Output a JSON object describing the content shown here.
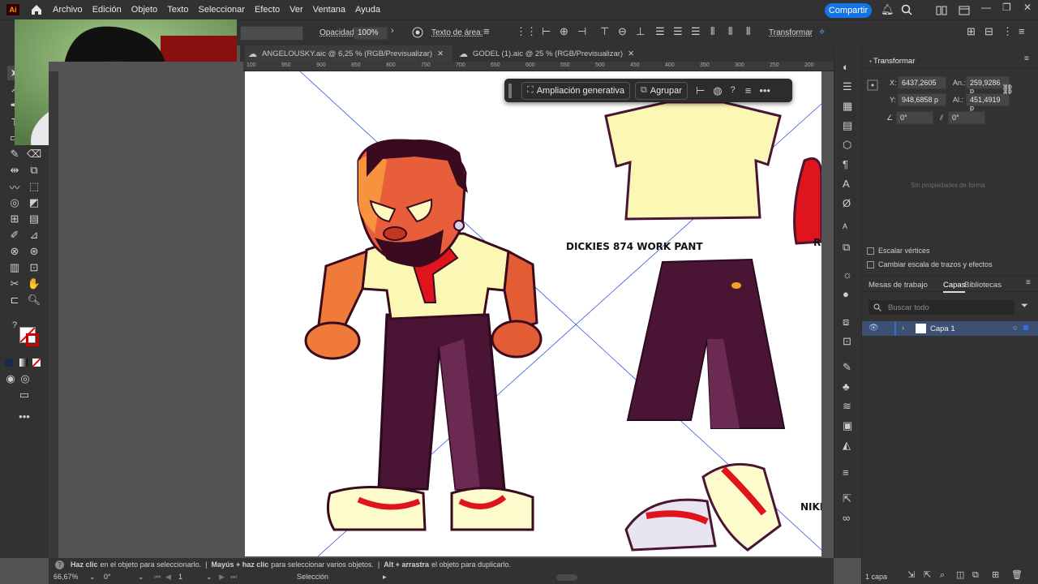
{
  "menubar": {
    "items": [
      "Archivo",
      "Edición",
      "Objeto",
      "Texto",
      "Seleccionar",
      "Efecto",
      "Ver",
      "Ventana",
      "Ayuda"
    ],
    "share_label": "Compartir"
  },
  "controlbar": {
    "opacity_label": "Opacidad:",
    "opacity_value": "100%",
    "text_area_label": "Texto de área:",
    "transform_label": "Transformar"
  },
  "tabs": [
    {
      "label": "ANGELOUSKY.aic @ 6,25 % (RGB/Previsualizar)"
    },
    {
      "label": "GODEL (1).aic @ 25 % (RGB/Previsualizar)"
    }
  ],
  "ruler": {
    "ticks": [
      "100",
      "950",
      "900",
      "850",
      "800",
      "750",
      "700",
      "650",
      "600",
      "550",
      "500",
      "450",
      "400",
      "350",
      "300",
      "250",
      "200"
    ]
  },
  "context_bar": {
    "generative_label": "Ampliación generativa",
    "group_label": "Agrupar",
    "help_label": "?"
  },
  "artboard": {
    "pants_label": "DICKIES 874 WORK PANT",
    "shoes_label": "NIKE",
    "hat_label": "RE"
  },
  "transform_panel": {
    "title": "Transformar",
    "x_label": "X:",
    "x_value": "6437,2605",
    "an_label": "An.:",
    "an_value": "259,9286 p",
    "y_label": "Y:",
    "y_value": "948,6858 p",
    "al_label": "Al.:",
    "al_value": "451,4919 p",
    "rot_value": "0°",
    "shear_value": "0°",
    "empty_text": "Sin propiedades de forma",
    "scale_corners": "Escalar vértices",
    "scale_strokes": "Cambiar escala de trazos y efectos"
  },
  "layers_panel": {
    "tabs": [
      "Mesas de trabajo",
      "Capas",
      "Bibliotecas"
    ],
    "search_placeholder": "Buscar todo",
    "layer_name": "Capa 1",
    "count": "1 capa"
  },
  "hint": {
    "t1": "Haz clic",
    "t2": "en el objeto para seleccionarlo.",
    "t3": "Mayús + haz clic",
    "t4": "para seleccionar varios objetos.",
    "t5": "Alt + arrastra",
    "t6": "el objeto para duplicarlo."
  },
  "statusbar": {
    "zoom": "66,67%",
    "rotation": "0°",
    "artboard_num": "1",
    "tool": "Selección"
  },
  "colors": {
    "accent": "#1473e6",
    "panel": "#323232",
    "canvas": "#535353",
    "selection": "#3a57d6"
  }
}
